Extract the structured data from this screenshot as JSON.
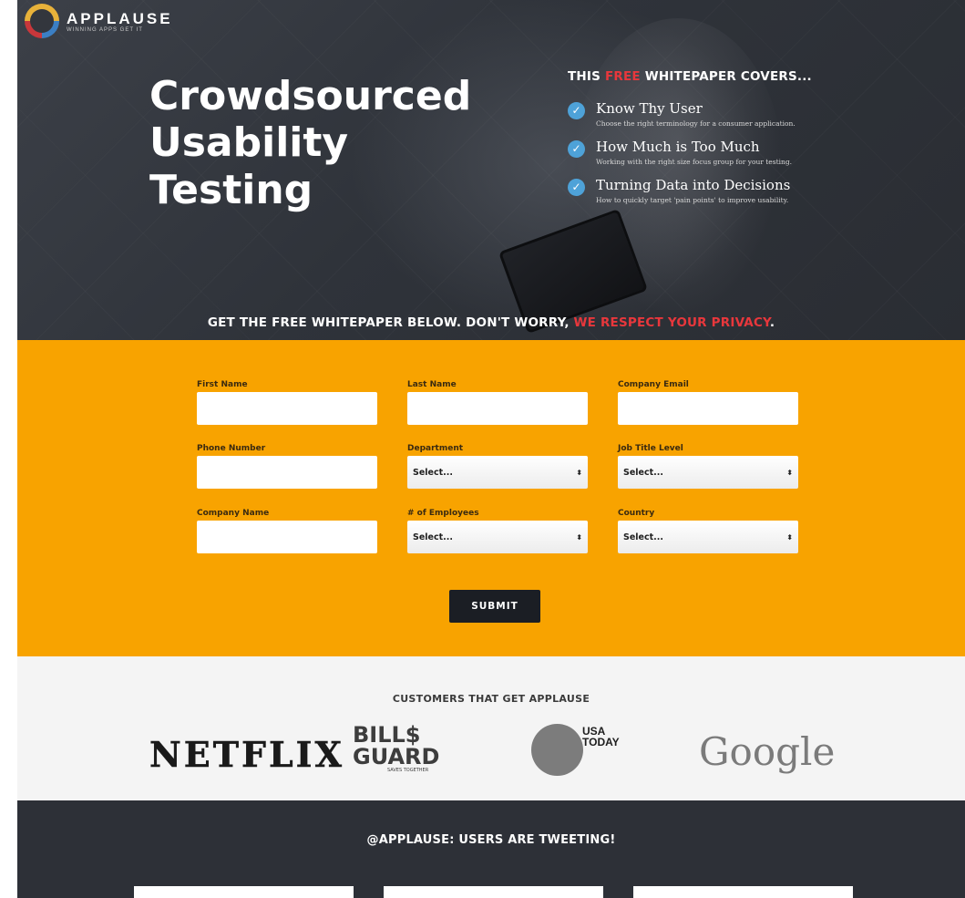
{
  "brand": {
    "name": "APPLAUSE",
    "tagline": "WINNING APPS GET IT"
  },
  "hero": {
    "headline": [
      "Crowdsourced",
      "Usability",
      "Testing"
    ],
    "covers_title_prefix": "THIS ",
    "covers_title_highlight": "FREE",
    "covers_title_suffix": " WHITEPAPER COVERS...",
    "items": [
      {
        "title": "Know Thy User",
        "desc": "Choose the right terminology for a consumer application."
      },
      {
        "title": "How Much is Too Much",
        "desc": "Working with the right size focus group for your testing."
      },
      {
        "title": "Turning Data into Decisions",
        "desc": "How to quickly target 'pain points' to improve usability."
      }
    ],
    "privacy_prefix": "GET THE FREE WHITEPAPER BELOW. DON'T WORRY, ",
    "privacy_highlight": "WE RESPECT YOUR PRIVACY",
    "privacy_suffix": "."
  },
  "form": {
    "first_name": {
      "label": "First Name",
      "value": ""
    },
    "last_name": {
      "label": "Last Name",
      "value": ""
    },
    "company_email": {
      "label": "Company Email",
      "value": ""
    },
    "phone_number": {
      "label": "Phone Number",
      "value": ""
    },
    "department": {
      "label": "Department",
      "selected": "Select..."
    },
    "job_title_level": {
      "label": "Job Title Level",
      "selected": "Select..."
    },
    "company_name": {
      "label": "Company Name",
      "value": ""
    },
    "employees": {
      "label": "# of Employees",
      "selected": "Select..."
    },
    "country": {
      "label": "Country",
      "selected": "Select..."
    },
    "submit_label": "SUBMIT"
  },
  "customers": {
    "title": "CUSTOMERS THAT GET APPLAUSE",
    "netflix": "NETFLIX",
    "billguard_line1": "BILL$",
    "billguard_line2": "GUARD",
    "billguard_tag": "SAVES TOGETHER",
    "usatoday_line1": "USA",
    "usatoday_line2": "TODAY",
    "google": "Google"
  },
  "tweets": {
    "title": "@APPLAUSE: USERS ARE TWEETING!"
  },
  "colors": {
    "accent_orange": "#f8a300",
    "highlight_red": "#e8373c",
    "dark": "#2d3037",
    "check_blue": "#4ea2d8"
  }
}
